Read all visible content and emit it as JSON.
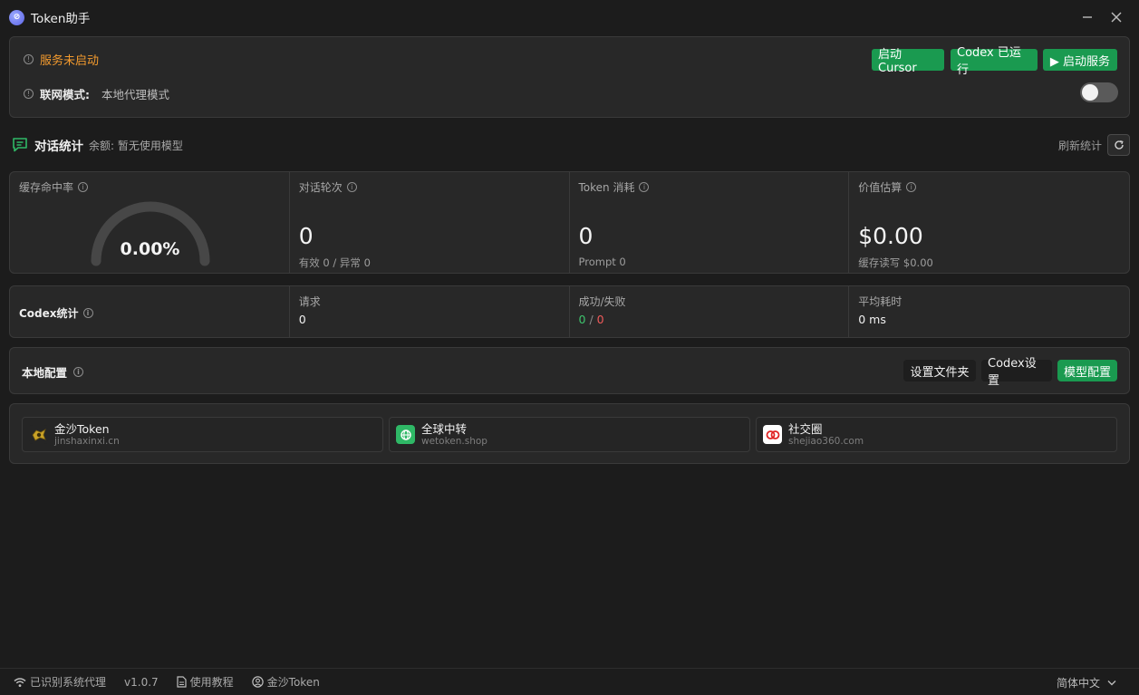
{
  "app": {
    "title": "Token助手",
    "logo_glyph": "⊘"
  },
  "status": {
    "service_status": "服务未启动",
    "network_mode_label": "联网模式:",
    "network_mode_value": "本地代理模式",
    "buttons": {
      "start_cursor": "启动Cursor",
      "codex_running": "Codex 已运行",
      "start_service": "▶ 启动服务"
    },
    "toggle_on": false,
    "colors": {
      "warning": "#f29a2e",
      "accent": "#1a9a50"
    }
  },
  "chat_stats": {
    "title": "对话统计",
    "balance": "余额: 暂无使用模型",
    "refresh_label": "刷新统计",
    "cache_hit": {
      "label": "缓存命中率",
      "value": "0.00%",
      "fraction": 0.0
    },
    "rounds": {
      "label": "对话轮次",
      "value": "0",
      "sub": "有效 0 / 异常 0"
    },
    "token_usage": {
      "label": "Token 消耗",
      "value": "0",
      "sub": "Prompt 0"
    },
    "value_estimate": {
      "label": "价值估算",
      "value": "$0.00",
      "sub": "缓存读写 $0.00"
    }
  },
  "codex_stats": {
    "title": "Codex统计",
    "requests": {
      "label": "请求",
      "value": "0"
    },
    "success_fail": {
      "label": "成功/失败",
      "success": "0",
      "sep": "/",
      "fail": "0"
    },
    "avg_time": {
      "label": "平均耗时",
      "value": "0 ms"
    }
  },
  "local_config": {
    "title": "本地配置",
    "buttons": {
      "folder": "设置文件夹",
      "codex": "Codex设置",
      "model": "模型配置"
    }
  },
  "links": [
    {
      "name": "金沙Token",
      "url": "jinshaxinxi.cn",
      "icon": "jinsha-logo-icon"
    },
    {
      "name": "全球中转",
      "url": "wetoken.shop",
      "icon": "wetoken-logo-icon"
    },
    {
      "name": "社交圈",
      "url": "shejiao360.com",
      "icon": "shejiao-logo-icon"
    }
  ],
  "footer": {
    "proxy": "已识别系统代理",
    "version": "v1.0.7",
    "tutorial": "使用教程",
    "account": "金沙Token",
    "language": "简体中文"
  }
}
